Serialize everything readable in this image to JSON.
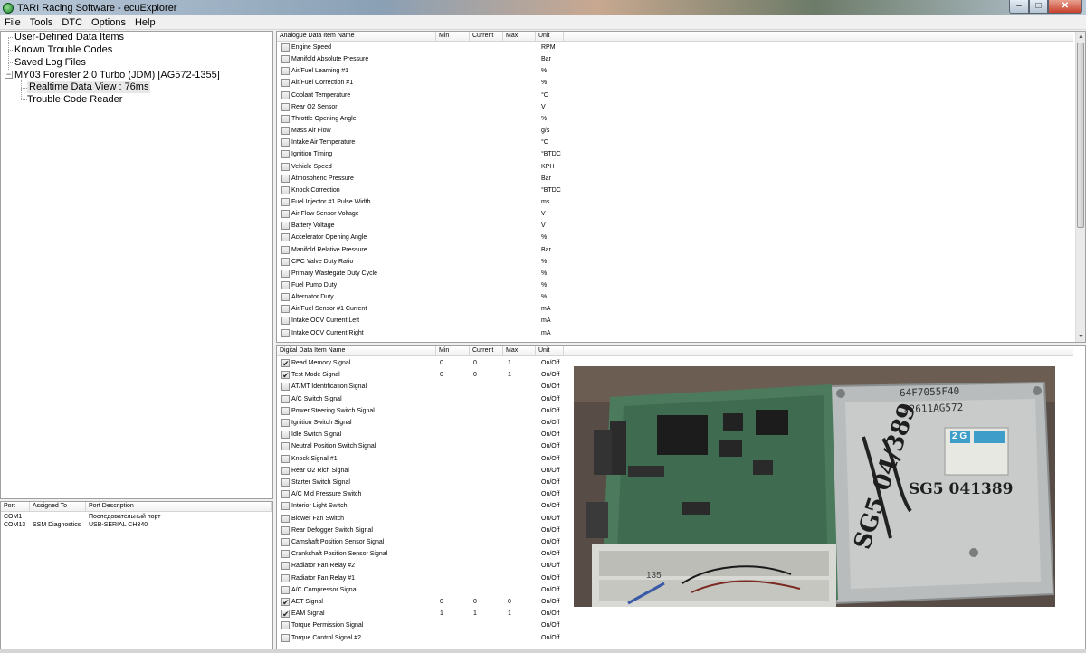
{
  "window": {
    "title": "TARI Racing Software - ecuExplorer",
    "min": "‒",
    "max": "□",
    "close": "✕"
  },
  "menu": [
    "File",
    "Tools",
    "DTC",
    "Options",
    "Help"
  ],
  "tree": {
    "items": [
      "User-Defined Data Items",
      "Known Trouble Codes",
      "Saved Log Files",
      "MY03 Forester 2.0 Turbo (JDM) [AG572-1355]",
      "Realtime Data View : 76ms",
      "Trouble Code Reader"
    ],
    "expander": "−"
  },
  "ports": {
    "headers": [
      "Port",
      "Assigned To",
      "Port Description"
    ],
    "rows": [
      [
        "COM1",
        "",
        "Последовательный порт"
      ],
      [
        "COM13",
        "SSM Diagnostics",
        "USB-SERIAL CH340"
      ]
    ]
  },
  "analogue": {
    "headers": [
      "Analogue Data Item Name",
      "Min",
      "Current",
      "Max",
      "Unit"
    ],
    "rows": [
      [
        "Engine Speed",
        "RPM"
      ],
      [
        "Manifold Absolute Pressure",
        "Bar"
      ],
      [
        "Air/Fuel Learning #1",
        "%"
      ],
      [
        "Air/Fuel Correction #1",
        "%"
      ],
      [
        "Coolant Temperature",
        "°C"
      ],
      [
        "Rear O2 Sensor",
        "V"
      ],
      [
        "Throttle Opening Angle",
        "%"
      ],
      [
        "Mass Air Flow",
        "g/s"
      ],
      [
        "Intake Air Temperature",
        "°C"
      ],
      [
        "Ignition Timing",
        "°BTDC"
      ],
      [
        "Vehicle Speed",
        "KPH"
      ],
      [
        "Atmospheric Pressure",
        "Bar"
      ],
      [
        "Knock Correction",
        "°BTDC"
      ],
      [
        "Fuel Injector #1 Pulse Width",
        "ms"
      ],
      [
        "Air Flow Sensor Voltage",
        "V"
      ],
      [
        "Battery Voltage",
        "V"
      ],
      [
        "Accelerator Opening Angle",
        "%"
      ],
      [
        "Manifold Relative Pressure",
        "Bar"
      ],
      [
        "CPC Valve Duty Ratio",
        "%"
      ],
      [
        "Primary Wastegate Duty Cycle",
        "%"
      ],
      [
        "Fuel Pump Duty",
        "%"
      ],
      [
        "Alternator Duty",
        "%"
      ],
      [
        "Air/Fuel Sensor #1 Current",
        "mA"
      ],
      [
        "Intake OCV Current Left",
        "mA"
      ],
      [
        "Intake OCV Current Right",
        "mA"
      ]
    ]
  },
  "digital": {
    "headers": [
      "Digital Data Item Name",
      "Min",
      "Current",
      "Max",
      "Unit"
    ],
    "rows": [
      {
        "name": "Read Memory Signal",
        "checked": true,
        "min": "0",
        "cur": "0",
        "max": "1",
        "unit": "On/Off"
      },
      {
        "name": "Test Mode Signal",
        "checked": true,
        "min": "0",
        "cur": "0",
        "max": "1",
        "unit": "On/Off"
      },
      {
        "name": "AT/MT Identification Signal",
        "checked": false,
        "min": "",
        "cur": "",
        "max": "",
        "unit": "On/Off"
      },
      {
        "name": "A/C Switch Signal",
        "checked": false,
        "min": "",
        "cur": "",
        "max": "",
        "unit": "On/Off"
      },
      {
        "name": "Power Steering Switch Signal",
        "checked": false,
        "min": "",
        "cur": "",
        "max": "",
        "unit": "On/Off"
      },
      {
        "name": "Ignition Switch Signal",
        "checked": false,
        "min": "",
        "cur": "",
        "max": "",
        "unit": "On/Off"
      },
      {
        "name": "Idle Switch Signal",
        "checked": false,
        "min": "",
        "cur": "",
        "max": "",
        "unit": "On/Off"
      },
      {
        "name": "Neutral Position Switch Signal",
        "checked": false,
        "min": "",
        "cur": "",
        "max": "",
        "unit": "On/Off"
      },
      {
        "name": "Knock Signal #1",
        "checked": false,
        "min": "",
        "cur": "",
        "max": "",
        "unit": "On/Off"
      },
      {
        "name": "Rear O2 Rich Signal",
        "checked": false,
        "min": "",
        "cur": "",
        "max": "",
        "unit": "On/Off"
      },
      {
        "name": "Starter Switch Signal",
        "checked": false,
        "min": "",
        "cur": "",
        "max": "",
        "unit": "On/Off"
      },
      {
        "name": "A/C Mid Pressure Switch",
        "checked": false,
        "min": "",
        "cur": "",
        "max": "",
        "unit": "On/Off"
      },
      {
        "name": "Interior Light Switch",
        "checked": false,
        "min": "",
        "cur": "",
        "max": "",
        "unit": "On/Off"
      },
      {
        "name": "Blower Fan Switch",
        "checked": false,
        "min": "",
        "cur": "",
        "max": "",
        "unit": "On/Off"
      },
      {
        "name": "Rear Defogger Switch Signal",
        "checked": false,
        "min": "",
        "cur": "",
        "max": "",
        "unit": "On/Off"
      },
      {
        "name": "Camshaft Position Sensor Signal",
        "checked": false,
        "min": "",
        "cur": "",
        "max": "",
        "unit": "On/Off"
      },
      {
        "name": "Crankshaft Position Sensor Signal",
        "checked": false,
        "min": "",
        "cur": "",
        "max": "",
        "unit": "On/Off"
      },
      {
        "name": "Radiator Fan Relay #2",
        "checked": false,
        "min": "",
        "cur": "",
        "max": "",
        "unit": "On/Off"
      },
      {
        "name": "Radiator Fan Relay #1",
        "checked": false,
        "min": "",
        "cur": "",
        "max": "",
        "unit": "On/Off"
      },
      {
        "name": "A/C Compressor Signal",
        "checked": false,
        "min": "",
        "cur": "",
        "max": "",
        "unit": "On/Off"
      },
      {
        "name": "AET Signal",
        "checked": true,
        "min": "0",
        "cur": "0",
        "max": "0",
        "unit": "On/Off"
      },
      {
        "name": "EAM Signal",
        "checked": true,
        "min": "1",
        "cur": "1",
        "max": "1",
        "unit": "On/Off"
      },
      {
        "name": "Torque Permission Signal",
        "checked": false,
        "min": "",
        "cur": "",
        "max": "",
        "unit": "On/Off"
      },
      {
        "name": "Torque Control Signal #2",
        "checked": false,
        "min": "",
        "cur": "",
        "max": "",
        "unit": "On/Off"
      }
    ]
  },
  "photo": {
    "label_top": "64F7055F40",
    "label_part": "22611AG572",
    "sticker": "2 G",
    "marker_big": "SG5 04/389",
    "marker_small": "SG5 041389",
    "board_number": "135"
  },
  "icons": {
    "checkbox_checked": "✔",
    "scroll_up": "▲",
    "scroll_down": "▼"
  }
}
